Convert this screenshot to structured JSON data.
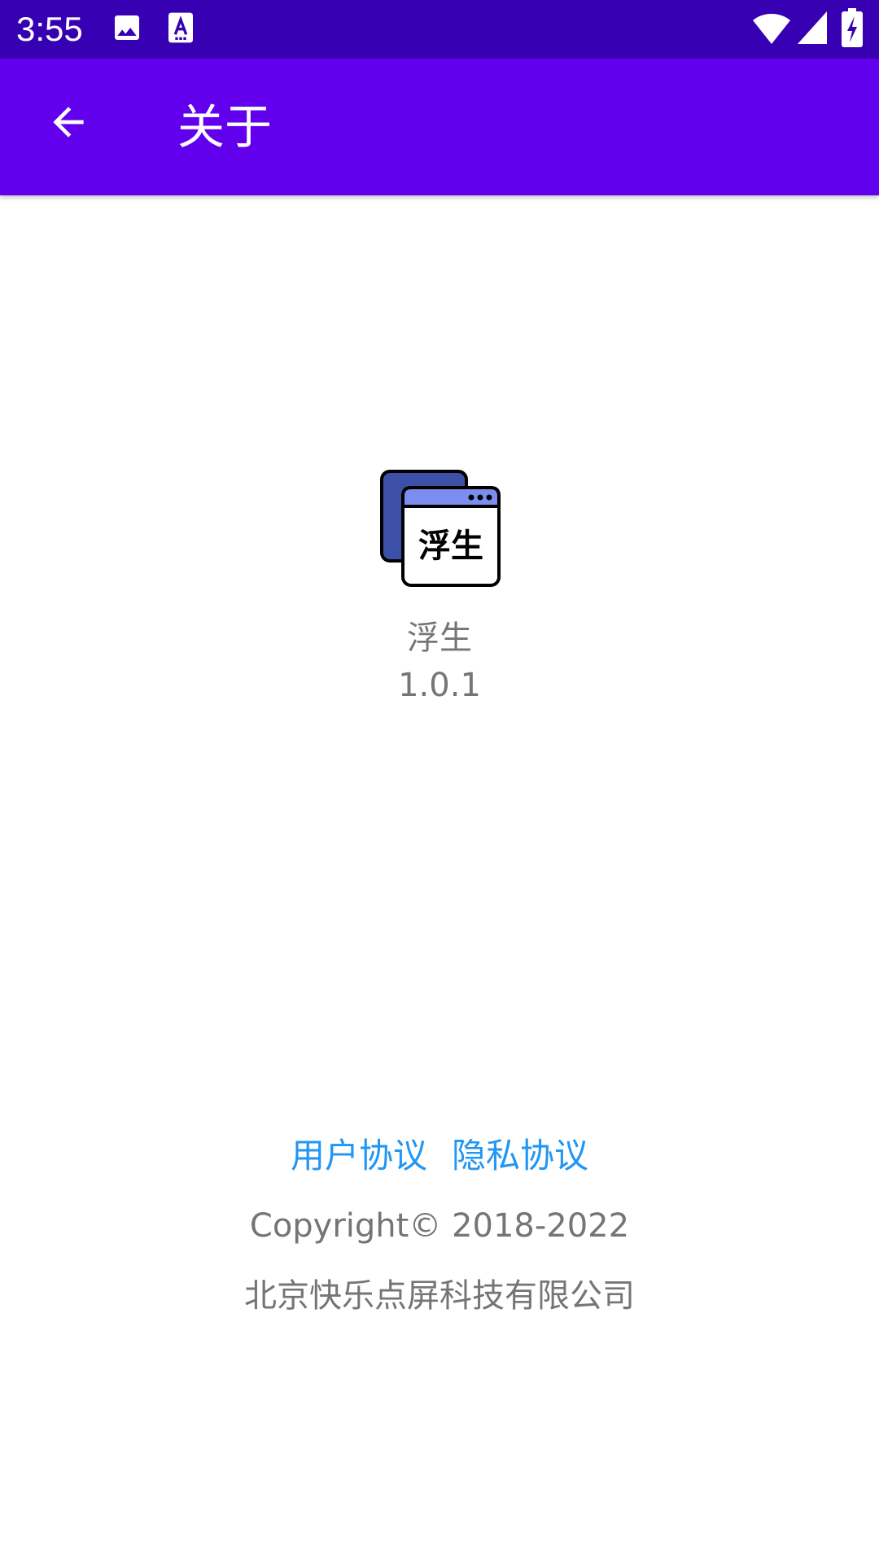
{
  "status_bar": {
    "time": "3:55",
    "icons": [
      "image-icon",
      "font-a-icon",
      "wifi-icon",
      "signal-icon",
      "battery-charging-icon"
    ]
  },
  "app_bar": {
    "title": "关于",
    "back_icon": "arrow-back-icon"
  },
  "about": {
    "logo_text": "浮生",
    "app_name": "浮生",
    "version": "1.0.1"
  },
  "footer": {
    "user_agreement": "用户协议",
    "privacy_policy": "隐私协议",
    "copyright": "Copyright© 2018-2022",
    "company": "北京快乐点屏科技有限公司"
  },
  "colors": {
    "status_bar": "#3700b3",
    "app_bar": "#6200ee",
    "link": "#2196f3",
    "secondary_text": "#757575"
  }
}
